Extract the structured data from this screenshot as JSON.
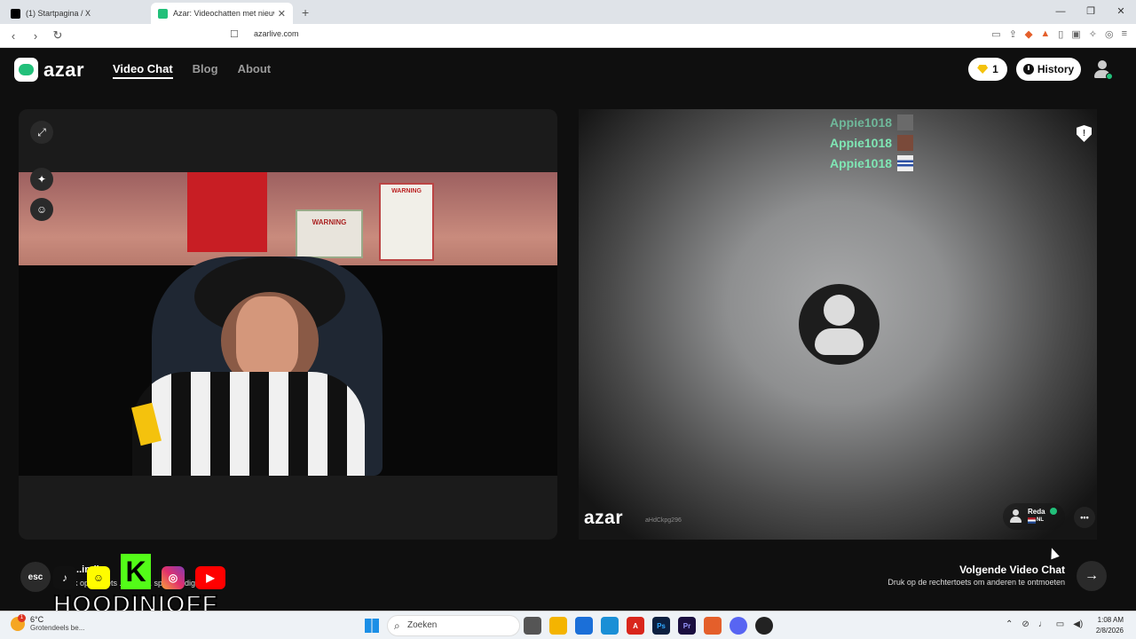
{
  "browser": {
    "tabs": [
      {
        "title": "(1) Startpagina / X",
        "active": false,
        "favicon_color": "#000000"
      },
      {
        "title": "Azar: Videochatten met nieuw",
        "active": true,
        "favicon_color": "#22c07a"
      }
    ],
    "new_tab": "+",
    "window_controls": [
      "—",
      "❐",
      "✕"
    ],
    "nav": {
      "back": "‹",
      "forward": "›",
      "reload": "↻"
    },
    "url": "azarlive.com"
  },
  "site": {
    "brand": "azar",
    "nav": [
      {
        "label": "Video Chat",
        "active": true
      },
      {
        "label": "Blog",
        "active": false
      },
      {
        "label": "About",
        "active": false
      }
    ],
    "gems_count": "1",
    "history_label": "History"
  },
  "left_video": {
    "sign_left": "WARNING",
    "sign_right": "WARNING",
    "controls": [
      "expand-icon",
      "magic-wand-icon",
      "sticker-icon"
    ]
  },
  "right_video": {
    "viewer_names": [
      {
        "name": "Appie1018",
        "dim": true
      },
      {
        "name": "Appie1018",
        "dim": false
      },
      {
        "name": "Appie1018",
        "dim": false
      }
    ],
    "watermark": "azar",
    "user_id": "aHdCkpg296",
    "peer": {
      "name": "Reda",
      "country": "NL"
    },
    "chat_icon": "•••"
  },
  "bottom": {
    "esc_label": "esc",
    "left_hint_title": "...indig",
    "left_hint_sub": "k op ... toets ... de vi... spre... indigen.",
    "overlay_name": "HOODINIOFF",
    "socials": [
      "tiktok-icon",
      "snapchat-icon",
      "kick-icon",
      "instagram-icon",
      "youtube-icon"
    ],
    "kick_letter": "K",
    "next_title": "Volgende Video Chat",
    "next_sub": "Druk op de rechtertoets om anderen te ontmoeten",
    "next_icon": "→"
  },
  "taskbar": {
    "temperature": "6°C",
    "weather_desc": "Grotendeels be...",
    "weather_badge": "1",
    "search_placeholder": "Zoeken",
    "time": "1:08 AM",
    "date": "2/8/2026",
    "apps": [
      {
        "name": "task-view-icon",
        "label": "",
        "color": "#555555"
      },
      {
        "name": "file-explorer-icon",
        "label": "",
        "color": "#f4b400"
      },
      {
        "name": "store-icon",
        "label": "",
        "color": "#1b6fd8"
      },
      {
        "name": "edge-icon",
        "label": "",
        "color": "#1a8fd6"
      },
      {
        "name": "acrobat-icon",
        "label": "A",
        "color": "#d9261c"
      },
      {
        "name": "photoshop-icon",
        "label": "Ps",
        "color": "#0c2040"
      },
      {
        "name": "premiere-icon",
        "label": "Pr",
        "color": "#1b0f40"
      },
      {
        "name": "brave-icon",
        "label": "",
        "color": "#e45f2b"
      },
      {
        "name": "discord-icon",
        "label": "",
        "color": "#5865f2"
      },
      {
        "name": "obs-icon",
        "label": "",
        "color": "#222222"
      }
    ]
  }
}
